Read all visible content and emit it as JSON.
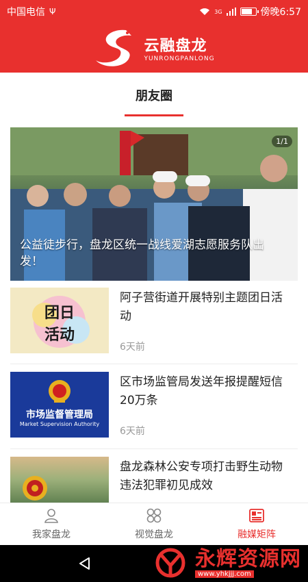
{
  "status_bar": {
    "carrier": "中国电信",
    "usb_icon": "usb-icon",
    "wifi_icon": "wifi-icon",
    "signal_label": "3G",
    "battery_icon": "battery-icon",
    "time": "傍晚6:57"
  },
  "header": {
    "logo_cn": "云融盘龙",
    "logo_en": "YUNRONGPANLONG"
  },
  "tabs": {
    "active": "朋友圈"
  },
  "hero": {
    "counter": "1/1",
    "caption": "公益徒步行，盘龙区统一战线爱湖志愿服务队出发！"
  },
  "news": [
    {
      "title": "阿子营街道开展特别主题团日活动",
      "time": "6天前",
      "thumb_text": "团日活动"
    },
    {
      "title": "区市场监管局发送年报提醒短信20万条",
      "time": "6天前",
      "thumb_cn": "市场监督管理局",
      "thumb_en": "Market Supervision Authority"
    },
    {
      "title": "盘龙森林公安专项打击野生动物违法犯罪初见成效",
      "time": ""
    }
  ],
  "bottom_nav": [
    {
      "label": "我家盘龙",
      "icon": "person-icon"
    },
    {
      "label": "视觉盘龙",
      "icon": "grid-icon"
    },
    {
      "label": "融媒矩阵",
      "icon": "newspaper-icon"
    }
  ],
  "watermark": {
    "cn": "永辉资源网",
    "url": "www.yhkjjj.com"
  },
  "colors": {
    "accent": "#e8302e",
    "text": "#222222",
    "muted": "#999999"
  }
}
